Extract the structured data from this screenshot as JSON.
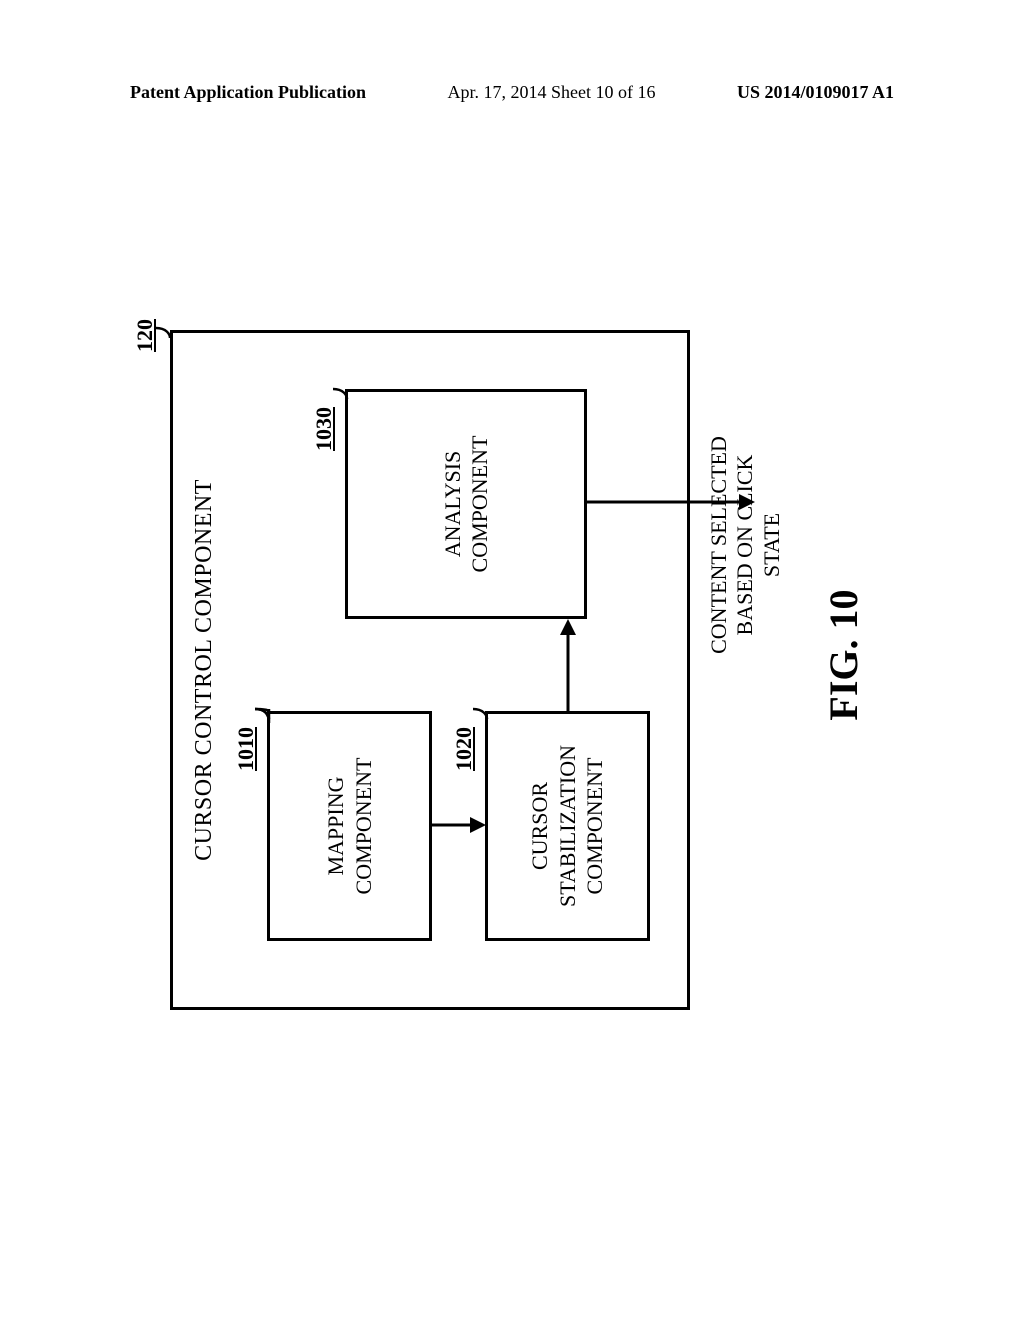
{
  "header": {
    "left": "Patent Application Publication",
    "mid": "Apr. 17, 2014  Sheet 10 of 16",
    "right": "US 2014/0109017 A1"
  },
  "diagram": {
    "outer_title": "CURSOR CONTROL COMPONENT",
    "ref_outer": "120",
    "boxes": {
      "mapping": {
        "label": "MAPPING\nCOMPONENT",
        "ref": "1010"
      },
      "cursor_stabilization": {
        "label": "CURSOR\nSTABILIZATION\nCOMPONENT",
        "ref": "1020"
      },
      "analysis": {
        "label": "ANALYSIS\nCOMPONENT",
        "ref": "1030"
      }
    },
    "output_label": "CONTENT SELECTED\nBASED ON CLICK\nSTATE",
    "figure_label": "FIG. 10"
  }
}
